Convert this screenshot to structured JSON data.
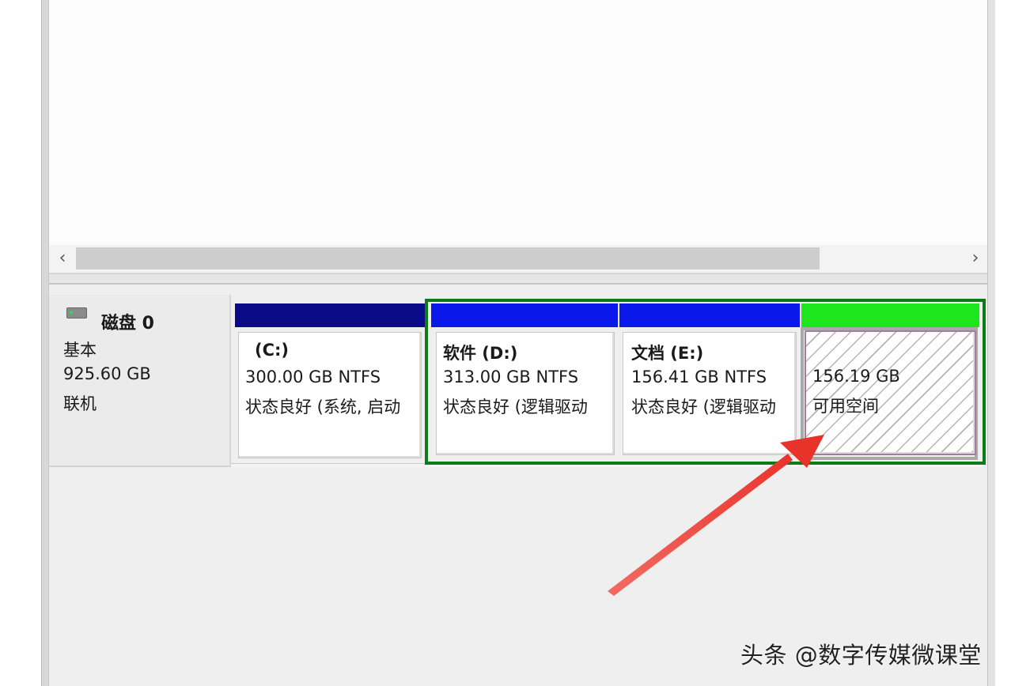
{
  "scrollbar": {
    "left_arrow": "‹",
    "right_arrow": "›"
  },
  "disk": {
    "title": "磁盘 0",
    "type": "基本",
    "size": "925.60 GB",
    "status": "联机",
    "icon": "disk-drive-icon"
  },
  "partitions": [
    {
      "label": "(C:)",
      "size_fs": "300.00 GB NTFS",
      "status": "状态良好 (系统, 启动",
      "stripe_color": "#0a0a86"
    },
    {
      "label": "软件  (D:)",
      "size_fs": "313.00 GB NTFS",
      "status": "状态良好 (逻辑驱动",
      "stripe_color": "#0a18ec"
    },
    {
      "label": "文档  (E:)",
      "size_fs": "156.41 GB NTFS",
      "status": "状态良好 (逻辑驱动",
      "stripe_color": "#0a18ec"
    },
    {
      "label": "",
      "size_fs": "156.19 GB",
      "status": "可用空间",
      "stripe_color": "#1ee61e"
    }
  ],
  "extended_partition_color": "#0c7a17",
  "annotation_arrow_color": "#ef3b34",
  "watermark": "头条 @数字传媒微课堂"
}
